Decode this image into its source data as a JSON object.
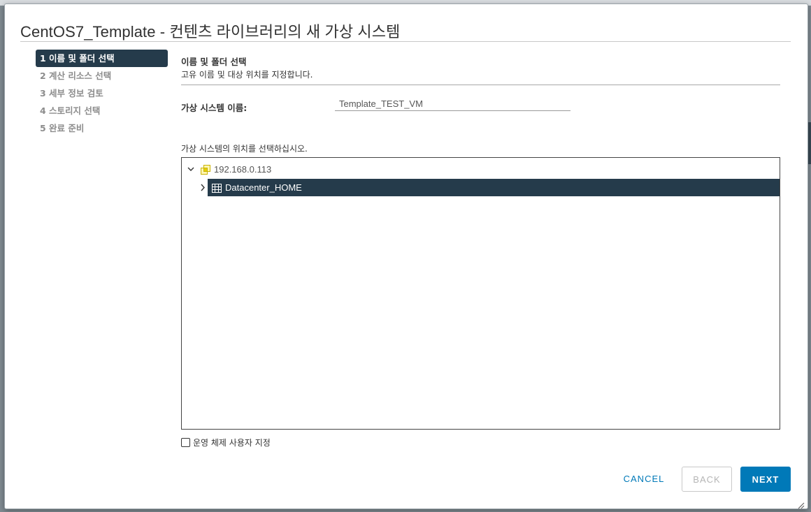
{
  "dialog": {
    "title": "CentOS7_Template - 컨텐츠 라이브러리의 새 가상 시스템"
  },
  "steps": [
    {
      "label": "1 이름 및 폴더 선택",
      "active": true
    },
    {
      "label": "2 계산 리소스 선택",
      "active": false
    },
    {
      "label": "3 세부 정보 검토",
      "active": false
    },
    {
      "label": "4 스토리지 선택",
      "active": false
    },
    {
      "label": "5 완료 준비",
      "active": false
    }
  ],
  "section": {
    "title": "이름 및 폴더 선택",
    "subtitle": "고유 이름 및 대상 위치를 지정합니다."
  },
  "vm_name": {
    "label": "가상 시스템 이름:",
    "value": "Template_TEST_VM"
  },
  "location": {
    "label": "가상 시스템의 위치를 선택하십시오.",
    "tree": [
      {
        "label": "192.168.0.113",
        "expanded": true,
        "icon": "vcenter-icon"
      },
      {
        "label": "Datacenter_HOME",
        "expanded": false,
        "selected": true,
        "icon": "datacenter-icon"
      }
    ]
  },
  "customize_os": {
    "label": "운영 체제 사용자 지정",
    "checked": false
  },
  "buttons": {
    "cancel": "CANCEL",
    "back": "BACK",
    "next": "NEXT"
  },
  "colors": {
    "accent": "#0079b8",
    "selected_bg": "#253b4b"
  }
}
